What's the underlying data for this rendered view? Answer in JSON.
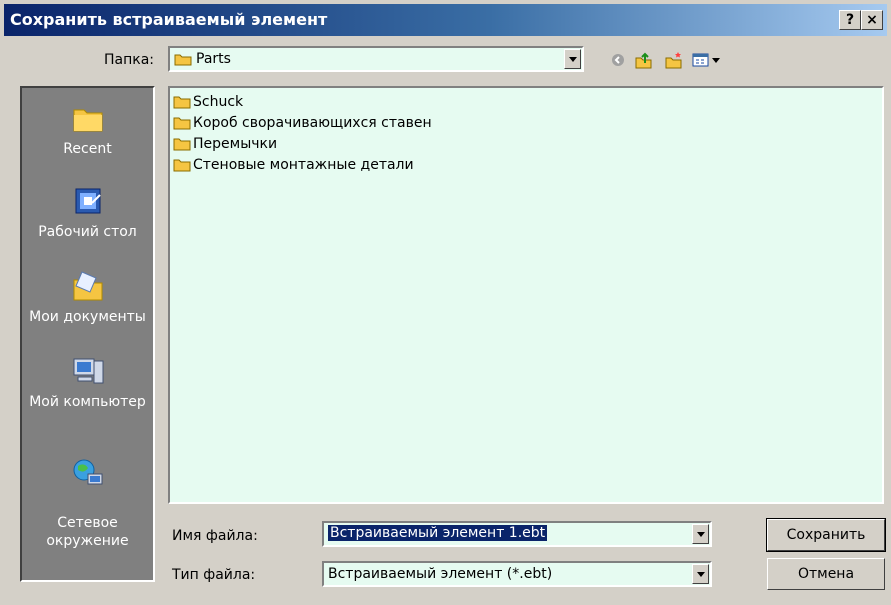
{
  "window": {
    "title": "Сохранить встраиваемый элемент",
    "help_label": "?",
    "close_label": "×"
  },
  "location": {
    "label": "Папка:",
    "value": "Parts"
  },
  "places": [
    {
      "label": "Recent",
      "icon": "folder-recent-icon"
    },
    {
      "label": "Рабочий стол",
      "icon": "desktop-icon"
    },
    {
      "label": "Мои документы",
      "icon": "my-documents-icon"
    },
    {
      "label": "Мой компьютер",
      "icon": "my-computer-icon"
    },
    {
      "label": "Сетевое\nокружение",
      "icon": "network-icon"
    }
  ],
  "files": [
    {
      "name": "Schuck",
      "icon": "folder-icon"
    },
    {
      "name": "Короб сворачивающихся ставен",
      "icon": "folder-icon"
    },
    {
      "name": "Перемычки",
      "icon": "folder-icon"
    },
    {
      "name": "Стеновые монтажные детали",
      "icon": "folder-icon"
    }
  ],
  "filename": {
    "label": "Имя файла:",
    "value": "Встраиваемый элемент 1.ebt"
  },
  "filetype": {
    "label": "Тип файла:",
    "value": "Встраиваемый элемент (*.ebt)"
  },
  "buttons": {
    "save": "Сохранить",
    "cancel": "Отмена"
  },
  "colors": {
    "title_start": "#0a246a",
    "title_end": "#a6caf0",
    "list_bg": "#e6fbf1",
    "places_bg": "#808080",
    "folder": "#f5c542"
  }
}
